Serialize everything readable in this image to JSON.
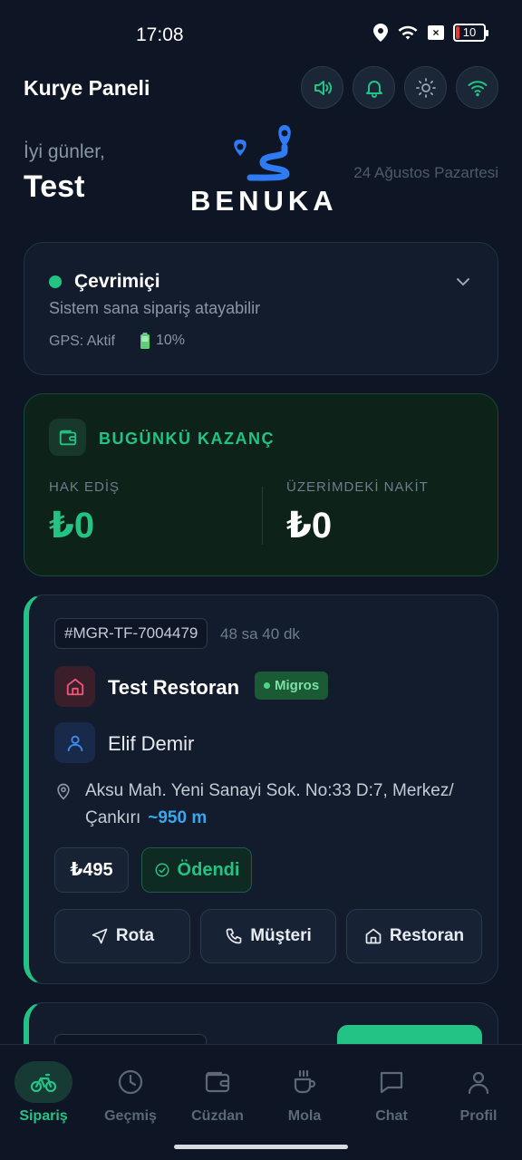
{
  "status_bar": {
    "time": "17:08",
    "battery": "10"
  },
  "header": {
    "title": "Kurye Paneli",
    "buttons": [
      "volume-icon",
      "bell-icon",
      "sun-icon",
      "wifi-icon"
    ]
  },
  "greeting": {
    "hello": "İyi günler,",
    "name": "Test",
    "date": "24 Ağustos Pazartesi"
  },
  "logo": {
    "text": "BENUKA"
  },
  "status_card": {
    "label": "Çevrimiçi",
    "subtitle": "Sistem sana sipariş atayabilir",
    "gps": "GPS: Aktif",
    "battery": "10%"
  },
  "earnings": {
    "title": "BUGÜNKÜ KAZANÇ",
    "left_label": "HAK EDİŞ",
    "left_value": "₺0",
    "right_label": "ÜZERİMDEKİ NAKİT",
    "right_value": "₺0"
  },
  "order": {
    "id": "#MGR-TF-7004479",
    "elapsed": "48 sa 40 dk",
    "restaurant": "Test Restoran",
    "brand": "Migros",
    "customer": "Elif Demir",
    "address": "Aksu Mah. Yeni Sanayi Sok. No:33 D:7, Merkez/Çankırı",
    "distance": "~950 m",
    "price": "₺495",
    "payment_status": "Ödendi",
    "actions": {
      "route": "Rota",
      "customer": "Müşteri",
      "restaurant": "Restoran"
    }
  },
  "nav": [
    {
      "label": "Sipariş",
      "icon": "bike-icon",
      "active": true
    },
    {
      "label": "Geçmiş",
      "icon": "clock-icon",
      "active": false
    },
    {
      "label": "Cüzdan",
      "icon": "wallet-icon",
      "active": false
    },
    {
      "label": "Mola",
      "icon": "coffee-icon",
      "active": false
    },
    {
      "label": "Chat",
      "icon": "chat-icon",
      "active": false
    },
    {
      "label": "Profil",
      "icon": "user-icon",
      "active": false
    }
  ],
  "colors": {
    "accent": "#22c385",
    "background": "#0e1626",
    "card": "#121c2c",
    "link": "#3ba7f0"
  }
}
